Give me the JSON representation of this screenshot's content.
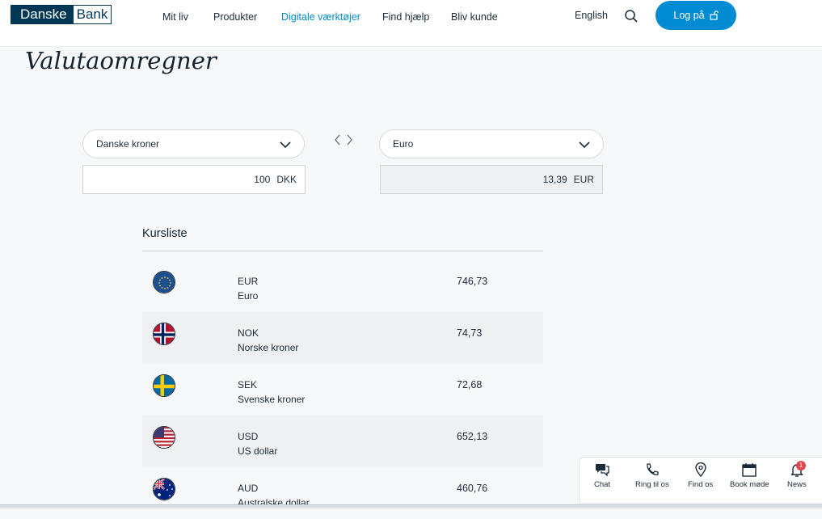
{
  "header": {
    "logo_left": "Danske",
    "logo_right": "Bank",
    "nav": [
      "Mit liv",
      "Produkter",
      "Digitale værktøjer",
      "Find hjælp",
      "Bliv kunde"
    ],
    "language": "English",
    "login_label": "Log på",
    "accent_color": "#008bd3"
  },
  "page": {
    "title": "Valutaomregner"
  },
  "converter": {
    "from_currency": "Danske kroner",
    "to_currency": "Euro",
    "from_amount": "100",
    "from_code": "DKK",
    "to_amount": "13,39",
    "to_code": "EUR"
  },
  "rates": {
    "heading": "Kursliste",
    "items": [
      {
        "code": "EUR",
        "name": "Euro",
        "rate": "746,73",
        "flag": "eu-flag-icon"
      },
      {
        "code": "NOK",
        "name": "Norske kroner",
        "rate": "74,73",
        "flag": "norway-flag-icon"
      },
      {
        "code": "SEK",
        "name": "Svenske kroner",
        "rate": "72,68",
        "flag": "sweden-flag-icon"
      },
      {
        "code": "USD",
        "name": "US dollar",
        "rate": "652,13",
        "flag": "usa-flag-icon"
      },
      {
        "code": "AUD",
        "name": "Australske dollar",
        "rate": "460,76",
        "flag": "australia-flag-icon"
      }
    ]
  },
  "help": {
    "items": [
      {
        "label": "Chat",
        "icon": "chat-icon"
      },
      {
        "label": "Ring til os",
        "icon": "phone-icon"
      },
      {
        "label": "Find os",
        "icon": "location-icon"
      },
      {
        "label": "Book møde",
        "icon": "calendar-icon"
      },
      {
        "label": "News",
        "icon": "bell-icon"
      }
    ],
    "news_badge": "1"
  }
}
